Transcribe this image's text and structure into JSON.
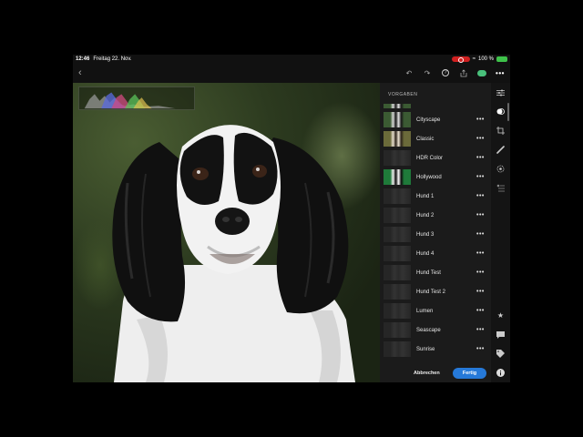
{
  "status_bar": {
    "time": "12:46",
    "date": "Freitag 22. Nov.",
    "battery_percent": "100 %"
  },
  "toolbar": {
    "icons": [
      "back-icon",
      "undo-icon",
      "redo-icon",
      "help-icon",
      "share-icon",
      "cloud-sync-icon",
      "more-icon"
    ]
  },
  "presets_panel": {
    "header": "VORGABEN",
    "presets": [
      {
        "label": "Cityscape",
        "thumb": "photo"
      },
      {
        "label": "Classic",
        "thumb": "warm"
      },
      {
        "label": "HDR Color",
        "thumb": "dim"
      },
      {
        "label": "Hollywood",
        "thumb": "vivid"
      },
      {
        "label": "Hund 1",
        "thumb": "dim"
      },
      {
        "label": "Hund 2",
        "thumb": "dim"
      },
      {
        "label": "Hund 3",
        "thumb": "dim"
      },
      {
        "label": "Hund 4",
        "thumb": "dim"
      },
      {
        "label": "Hund Test",
        "thumb": "dim"
      },
      {
        "label": "Hund Test 2",
        "thumb": "dim"
      },
      {
        "label": "Lumen",
        "thumb": "dim"
      },
      {
        "label": "Seascape",
        "thumb": "dim"
      },
      {
        "label": "Sunrise",
        "thumb": "dim"
      }
    ],
    "more_label": "•••",
    "cancel_label": "Abbrechen",
    "done_label": "Fertig"
  },
  "right_rail": {
    "icons": [
      "sliders-icon",
      "presets-icon",
      "crop-icon",
      "healing-brush-icon",
      "selective-icon",
      "versions-icon",
      "star-icon",
      "comment-icon",
      "tag-icon",
      "info-icon"
    ],
    "active": "presets-icon"
  },
  "colors": {
    "accent": "#2679d8",
    "panel_bg": "#1b1b1b",
    "record": "#d02020",
    "battery": "#3ec24a",
    "cloud": "#49c07b"
  }
}
